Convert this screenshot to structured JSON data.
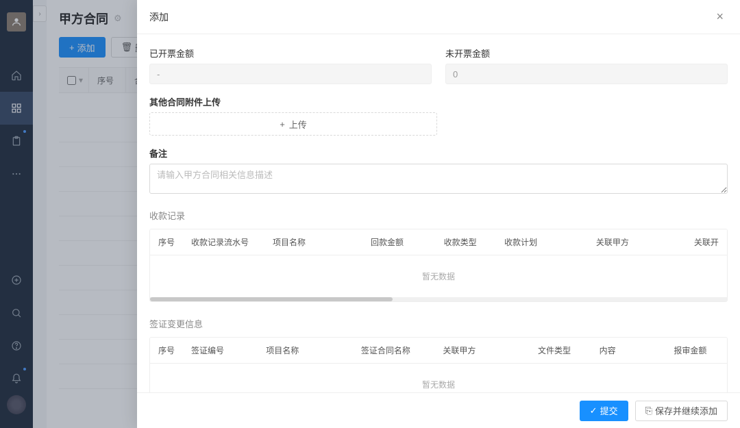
{
  "colors": {
    "primary": "#1890ff"
  },
  "sidebar": {
    "items": [
      {
        "name": "home-icon"
      },
      {
        "name": "apps-icon",
        "active": true
      },
      {
        "name": "clipboard-icon",
        "dot": true
      },
      {
        "name": "more-icon"
      }
    ],
    "bottom": [
      {
        "name": "plus-circle-icon"
      },
      {
        "name": "search-icon"
      },
      {
        "name": "help-icon"
      },
      {
        "name": "bell-icon",
        "dot": true
      }
    ]
  },
  "page": {
    "title": "甲方合同",
    "add_btn": "添加",
    "delete_btn": "删除",
    "table_headers": {
      "seq": "序号",
      "contract": "合"
    }
  },
  "drawer": {
    "title": "添加",
    "close": "×",
    "invoiced_label": "已开票金额",
    "invoiced_value": "-",
    "uninvoiced_label": "未开票金额",
    "uninvoiced_value": "0",
    "attachment_label": "其他合同附件上传",
    "upload_text": "上传",
    "remark_label": "备注",
    "remark_placeholder": "请输入甲方合同相关信息描述",
    "section_payment": "收款记录",
    "payment_headers": [
      "序号",
      "收款记录流水号",
      "项目名称",
      "回款金额",
      "收款类型",
      "收款计划",
      "关联甲方",
      "关联开"
    ],
    "empty_text": "暂无数据",
    "section_visa": "签证变更信息",
    "visa_headers": [
      "序号",
      "签证编号",
      "项目名称",
      "签证合同名称",
      "关联甲方",
      "文件类型",
      "内容",
      "报审金额"
    ],
    "footer": {
      "submit": "提交",
      "save_continue": "保存并继续添加"
    }
  }
}
